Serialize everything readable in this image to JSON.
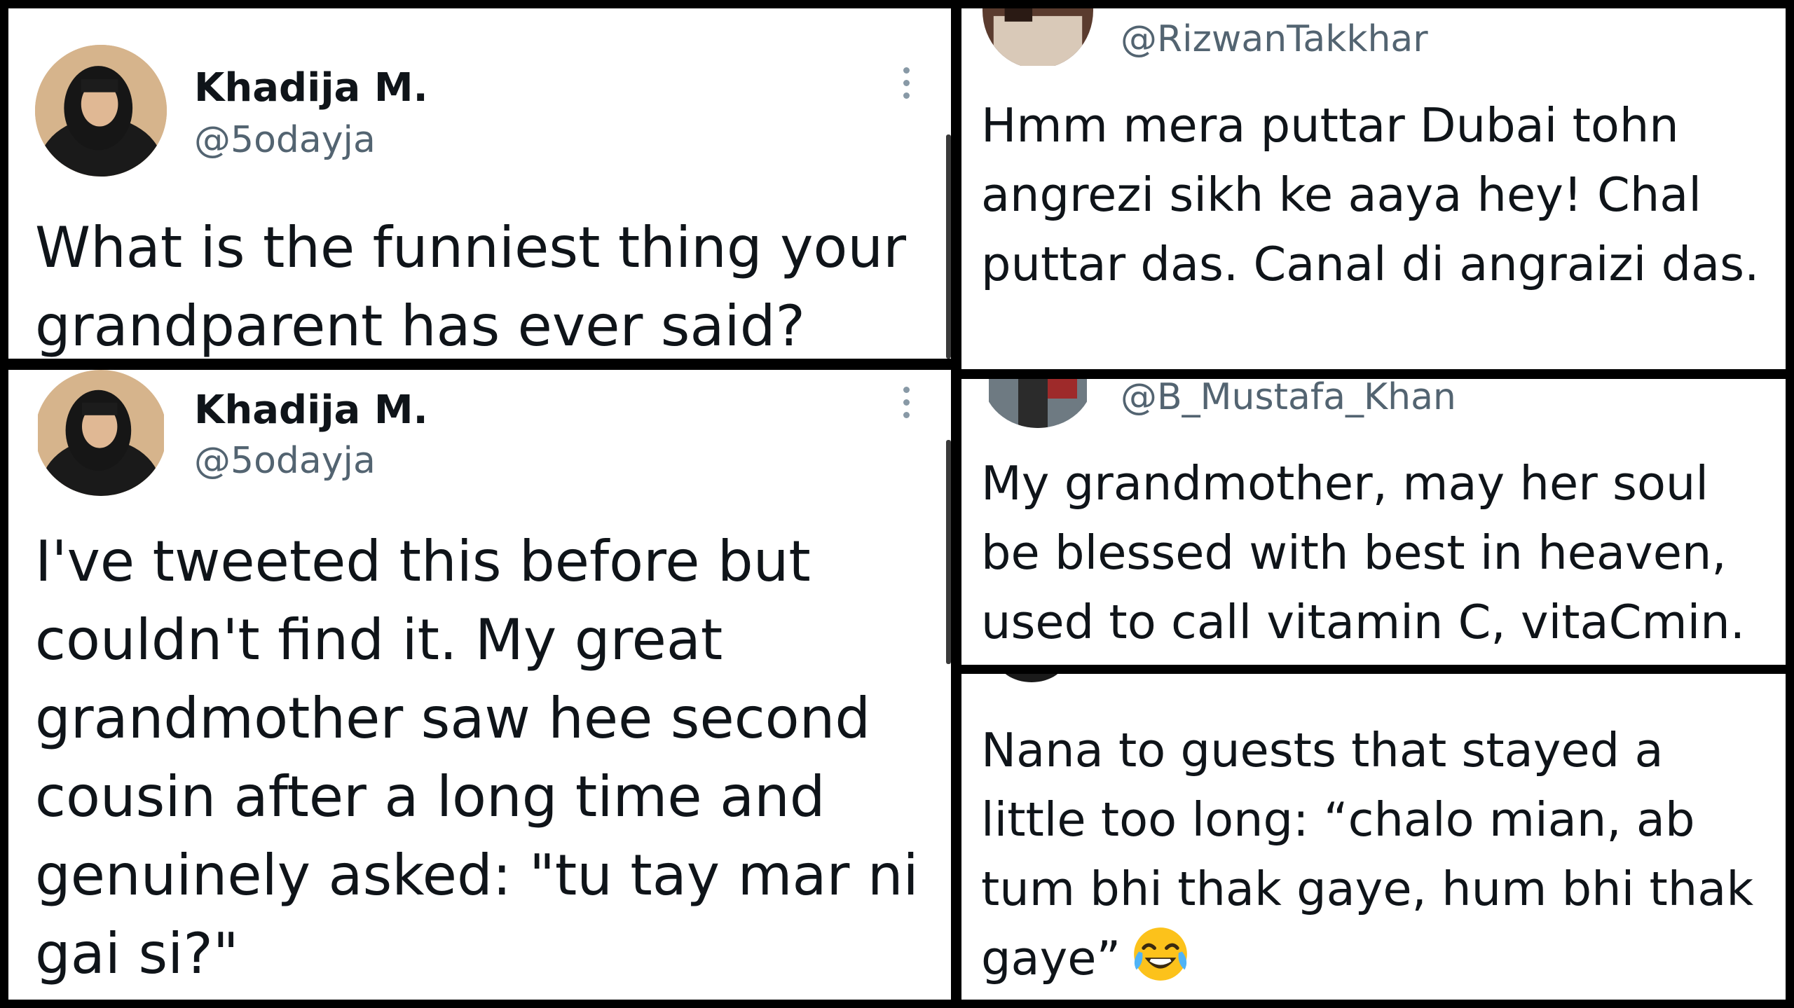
{
  "tweets": [
    {
      "name": "Khadija M.",
      "handle": "@5odayja",
      "text": "What is the funniest thing your grandparent has ever said?"
    },
    {
      "name": "Khadija M.",
      "handle": "@5odayja",
      "text": "I've tweeted this before but couldn't find it. My great grandmother saw hee second cousin after a long time and genuinely asked: \"tu tay mar ni gai si?\""
    }
  ],
  "replies": [
    {
      "handle": "@RizwanTakkhar",
      "text": "Hmm mera puttar Dubai tohn angrezi sikh ke aaya hey! Chal puttar das. Canal di angraizi das."
    },
    {
      "handle": "@B_Mustafa_Khan",
      "text": "My grandmother, may her soul be blessed with best in heaven, used to call vitamin C, vitaCmin."
    },
    {
      "handle": "",
      "text": "Nana to guests that stayed a little too long: “chalo mian, ab tum bhi thak gaye, hum bhi thak gaye”",
      "emoji": "face-with-tears-of-joy-icon"
    }
  ],
  "colors": {
    "text": "#0f1419",
    "secondary": "#536471",
    "background": "#ffffff",
    "divider": "#000000"
  }
}
